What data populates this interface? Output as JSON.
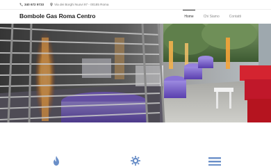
{
  "topbar": {
    "phone": "340 672 9733",
    "address": "Via dei Borghi Nuovi 97 - 00185 Roma"
  },
  "header": {
    "brand": "Bombole Gas Roma Centro",
    "nav": [
      {
        "label": "Home",
        "active": true
      },
      {
        "label": "Chi Siamo",
        "active": false
      },
      {
        "label": "Contatti",
        "active": false
      }
    ]
  },
  "hero": {
    "description": "Restaurant patio with tall patio gas heaters, purple covered tables and red sofas"
  },
  "features": [
    {
      "icon": "flame-icon"
    },
    {
      "icon": "gear-icon"
    },
    {
      "icon": "menu-icon"
    }
  ],
  "colors": {
    "accent": "#6a8fc8",
    "text_dark": "#222222",
    "text_muted": "#8a8a8a"
  }
}
